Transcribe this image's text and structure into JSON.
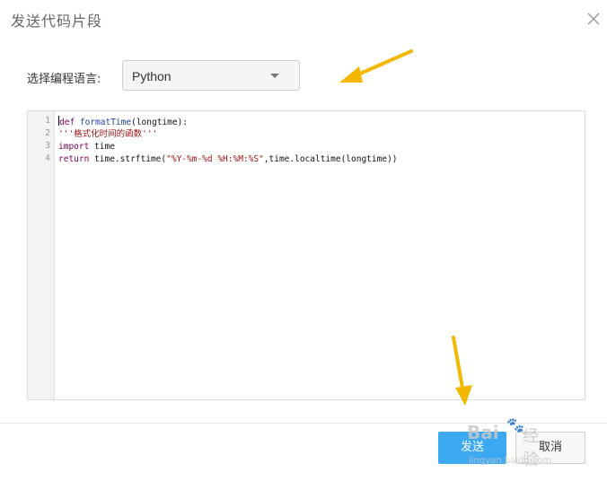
{
  "dialog": {
    "title": "发送代码片段",
    "close_icon": "close-icon"
  },
  "language": {
    "label": "选择编程语言:",
    "selected": "Python"
  },
  "editor": {
    "line_numbers": [
      "1",
      "2",
      "3",
      "4"
    ],
    "lines": [
      [
        {
          "t": "def ",
          "c": "kw"
        },
        {
          "t": "formatTime",
          "c": "fn"
        },
        {
          "t": "(longtime):",
          "c": ""
        }
      ],
      [
        {
          "t": "'''格式化时间的函数'''",
          "c": "str"
        }
      ],
      [
        {
          "t": "import ",
          "c": "kw"
        },
        {
          "t": "time",
          "c": ""
        }
      ],
      [
        {
          "t": "return ",
          "c": "kw"
        },
        {
          "t": "time.strftime(",
          "c": ""
        },
        {
          "t": "\"%Y-%m-%d %H:%M:%S\"",
          "c": "str"
        },
        {
          "t": ",time.localtime(longtime))",
          "c": ""
        }
      ]
    ]
  },
  "footer": {
    "send_label": "发送",
    "cancel_label": "取消"
  },
  "watermark": {
    "brand": "Bai",
    "text": "经验",
    "url": "jingyan.baidu.com"
  },
  "colors": {
    "accent": "#3ca9f3",
    "arrow": "#f5b800"
  }
}
